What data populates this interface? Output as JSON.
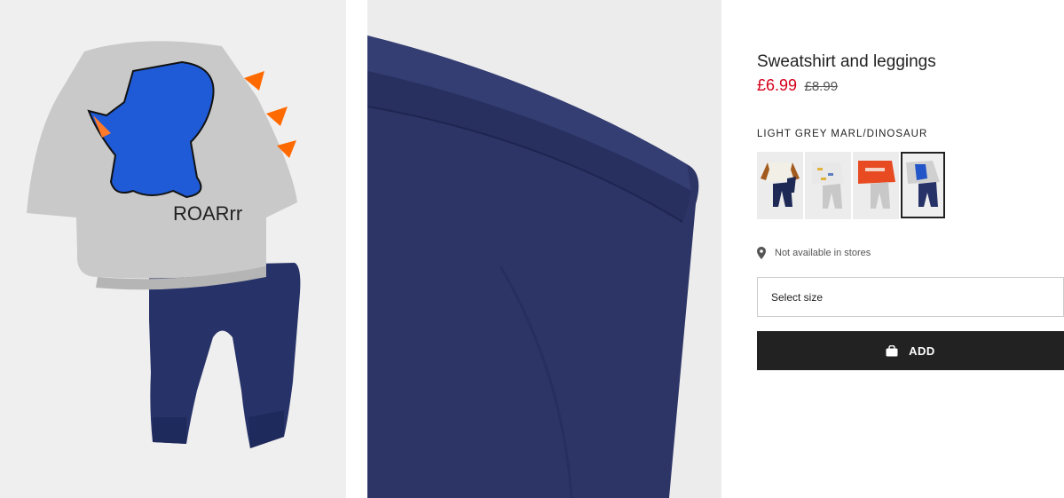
{
  "product": {
    "title": "Sweatshirt and leggings",
    "price_current": "£6.99",
    "price_original": "£8.99",
    "color_name": "LIGHT GREY MARL/DINOSAUR"
  },
  "images": {
    "main_print_text": "ROARrr"
  },
  "swatches": [
    {
      "id": "swatch-brown-sleeve",
      "selected": false
    },
    {
      "id": "swatch-cars-print",
      "selected": false
    },
    {
      "id": "swatch-orange-top",
      "selected": false
    },
    {
      "id": "swatch-dinosaur",
      "selected": true
    }
  ],
  "availability": {
    "text": "Not available in stores",
    "icon": "location-pin-icon"
  },
  "size_select": {
    "placeholder": "Select size"
  },
  "add_button": {
    "label": "ADD",
    "icon": "shopping-bag-icon"
  },
  "colors": {
    "sale_price": "#d6001c",
    "button_bg": "#222222",
    "panel_bg": "#efefef"
  }
}
